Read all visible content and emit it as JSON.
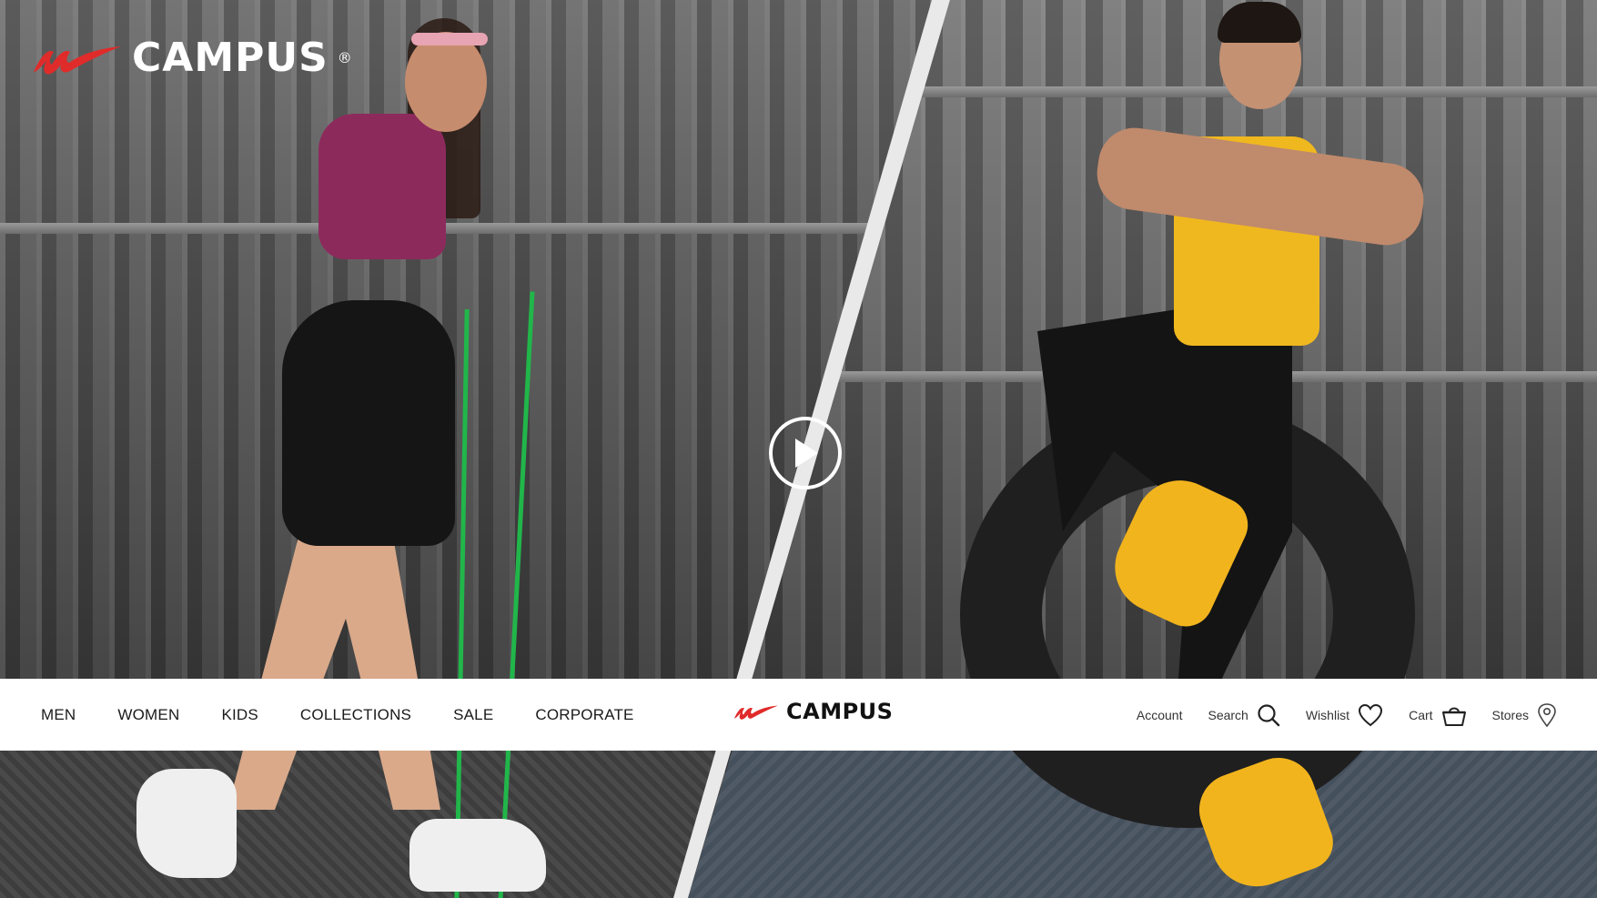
{
  "brand": {
    "name": "CAMPUS",
    "registered_mark": "®",
    "mark_color": "#e02b2b"
  },
  "hero": {
    "video_control": "play-icon"
  },
  "nav": {
    "links": [
      "MEN",
      "WOMEN",
      "KIDS",
      "COLLECTIONS",
      "SALE",
      "CORPORATE"
    ],
    "logo_text": "CAMPUS",
    "actions": {
      "account": "Account",
      "search": "Search",
      "wishlist": "Wishlist",
      "cart": "Cart",
      "stores": "Stores"
    },
    "icons": {
      "search": "search-icon",
      "wishlist": "heart-icon",
      "cart": "basket-icon",
      "stores": "location-pin-icon"
    }
  }
}
